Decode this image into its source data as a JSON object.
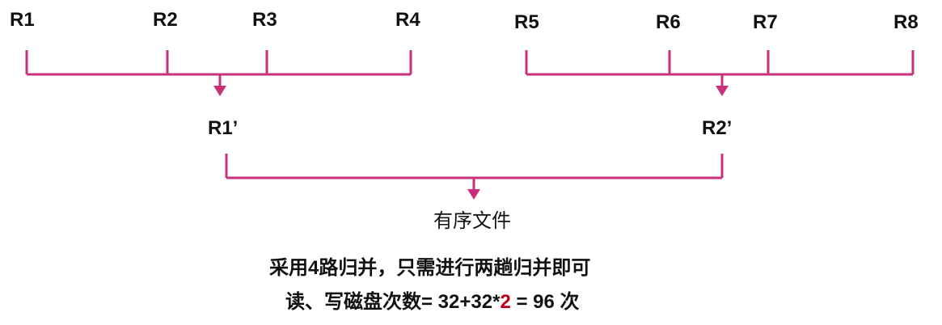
{
  "runs_left": [
    "R1",
    "R2",
    "R3",
    "R4"
  ],
  "runs_right": [
    "R5",
    "R6",
    "R7",
    "R8"
  ],
  "merged_left": "R1’",
  "merged_right": "R2’",
  "result": "有序文件",
  "note": {
    "line1": "采用4路归并，只需进行两趟归并即可",
    "line2_prefix": "读、写磁盘次数= 32+32*",
    "line2_highlight": "2",
    "line2_suffix": " = 96 次"
  },
  "colors": {
    "connector": "#c8307a",
    "highlight": "#c0001a",
    "text": "#111111"
  }
}
